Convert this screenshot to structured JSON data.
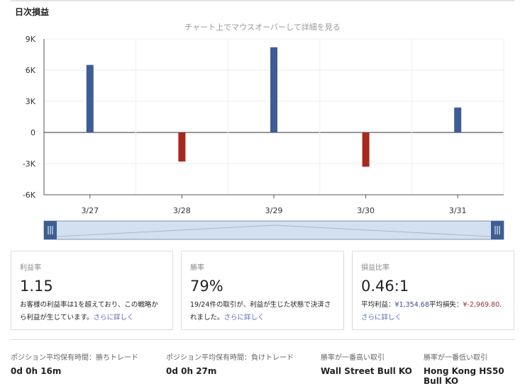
{
  "title": "日次損益",
  "hint": "チャート上でマウスオーバーして詳細を見る",
  "chart_data": {
    "type": "bar",
    "categories": [
      "3/27",
      "3/28",
      "3/29",
      "3/30",
      "3/31"
    ],
    "values": [
      6500,
      -2800,
      8200,
      -3300,
      2400
    ],
    "ylim": [
      -6000,
      9000
    ],
    "yticks": [
      9000,
      6000,
      3000,
      0,
      -3000,
      -6000
    ],
    "ytick_labels": [
      "9K",
      "6K",
      "3K",
      "0",
      "-3K",
      "-6K"
    ],
    "colors": {
      "positive": "#3d5e94",
      "negative": "#a8281f"
    },
    "grid": true
  },
  "cards": [
    {
      "label": "利益率",
      "value": "1.15",
      "desc": "お客様の利益率は1を超えており、この戦略から利益が生じています。",
      "link": "さらに詳しく"
    },
    {
      "label": "勝率",
      "value": "79%",
      "desc": "19/24件の取引が、利益が生じた状態で決済されました。",
      "link": "さらに詳しく"
    },
    {
      "label": "損益比率",
      "value": "0.46:1",
      "avg_profit_label": "平均利益：",
      "avg_profit": "¥1,354.68",
      "avg_loss_label": "平均損失：",
      "avg_loss": "¥-2,969.80",
      "period": ".",
      "link": "さらに詳しく"
    }
  ],
  "stats": [
    {
      "label": "ポジション平均保有時間：勝ちトレード",
      "value": "0d 0h 16m"
    },
    {
      "label": "ポジション平均保有時間：負けトレード",
      "value": "0d 0h 27m"
    },
    {
      "label": "勝率が一番高い取引",
      "value": "Wall Street Bull KO"
    },
    {
      "label": "勝率が一番低い取引",
      "value": "Hong Kong HS50 Bull KO"
    }
  ]
}
